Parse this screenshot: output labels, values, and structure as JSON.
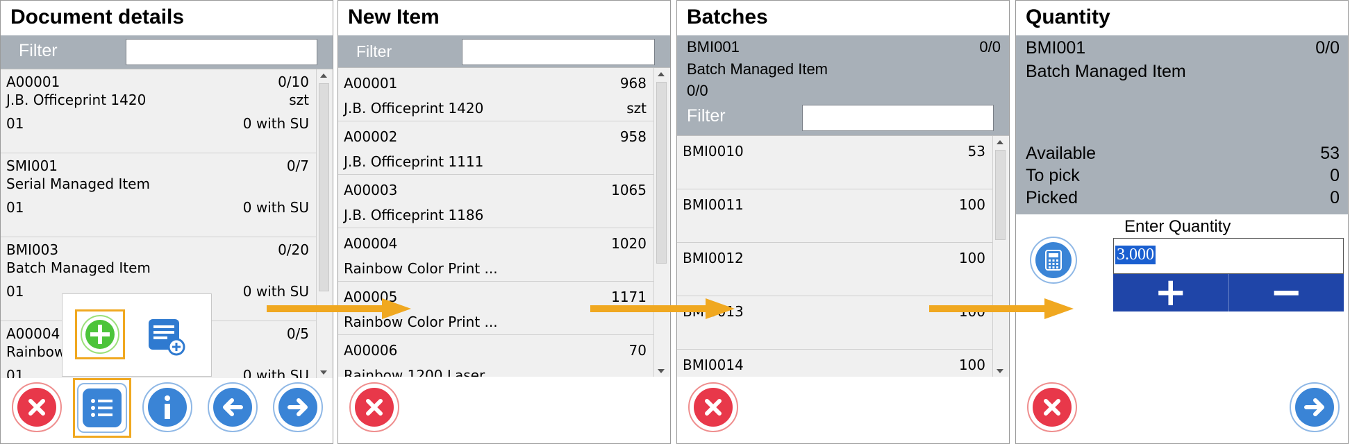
{
  "panels": {
    "document_details": {
      "title": "Document details",
      "filter_label": "Filter",
      "items": [
        {
          "code": "A00001",
          "qty": "0/10",
          "name": "J.B. Officeprint 1420",
          "unit": "szt",
          "wh": "01",
          "su": "0 with SU"
        },
        {
          "code": "SMI001",
          "qty": "0/7",
          "name": "Serial Managed Item",
          "unit": "",
          "wh": "01",
          "su": "0 with SU"
        },
        {
          "code": "BMI003",
          "qty": "0/20",
          "name": "Batch Managed Item",
          "unit": "",
          "wh": "01",
          "su": "0 with SU"
        },
        {
          "code": "A00004",
          "qty": "0/5",
          "name": "Rainbow",
          "unit": "",
          "wh": "01",
          "su": "0 with SU"
        }
      ],
      "buttons": [
        "cancel",
        "menu",
        "info",
        "back",
        "next"
      ]
    },
    "new_item": {
      "title": "New Item",
      "filter_label": "Filter",
      "items": [
        {
          "code": "A00001",
          "qty": "968",
          "name": "J.B. Officeprint 1420",
          "unit": "szt"
        },
        {
          "code": "A00002",
          "qty": "958",
          "name": "J.B. Officeprint 1111",
          "unit": ""
        },
        {
          "code": "A00003",
          "qty": "1065",
          "name": "J.B. Officeprint 1186",
          "unit": ""
        },
        {
          "code": "A00004",
          "qty": "1020",
          "name": "Rainbow Color Print ...",
          "unit": ""
        },
        {
          "code": "A00005",
          "qty": "1171",
          "name": "Rainbow Color Print ...",
          "unit": ""
        },
        {
          "code": "A00006",
          "qty": "70",
          "name": "Rainbow 1200 Laser",
          "unit": ""
        }
      ]
    },
    "batches": {
      "title": "Batches",
      "item_code": "BMI001",
      "item_qty": "0/0",
      "item_name": "Batch Managed Item",
      "item_sub_qty": "0/0",
      "filter_label": "Filter",
      "items": [
        {
          "code": "BMI0010",
          "qty": "53"
        },
        {
          "code": "BMI0011",
          "qty": "100"
        },
        {
          "code": "BMI0012",
          "qty": "100"
        },
        {
          "code": "BMI0013",
          "qty": "100"
        },
        {
          "code": "BMI0014",
          "qty": "100"
        }
      ]
    },
    "quantity": {
      "title": "Quantity",
      "item_code": "BMI001",
      "item_qty": "0/0",
      "item_name": "Batch Managed Item",
      "available_label": "Available",
      "available_value": "53",
      "to_pick_label": "To pick",
      "to_pick_value": "0",
      "picked_label": "Picked",
      "picked_value": "0",
      "enter_label": "Enter Quantity",
      "input_value": "3.000",
      "plus_label": "+",
      "minus_label": "−"
    }
  },
  "colors": {
    "header_bg": "#a8b0b8",
    "highlight": "#f0a820",
    "accent_blue": "#3a84d6",
    "accent_red": "#e8384a",
    "stepper_bg": "#1f45a8"
  }
}
